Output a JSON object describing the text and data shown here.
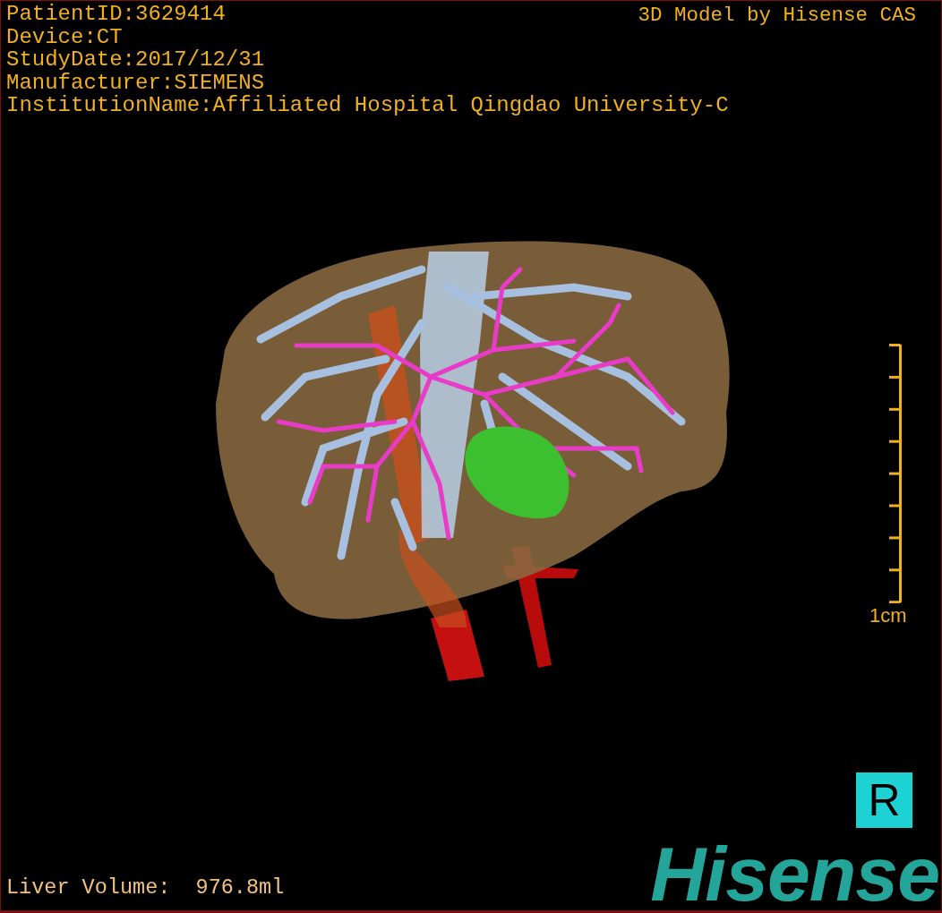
{
  "header": {
    "info_lines": [
      "PatientID:3629414",
      "Device:CT",
      "StudyDate:2017/12/31",
      "Manufacturer:SIEMENS",
      "InstitutionName:Affiliated Hospital Qingdao University-C"
    ],
    "title": "3D Model by Hisense CAS"
  },
  "scale_bar": {
    "label": "1cm"
  },
  "orientation_marker": "R",
  "logo": "Hisense",
  "footer": {
    "liver_volume": "Liver Volume:  976.8ml"
  }
}
